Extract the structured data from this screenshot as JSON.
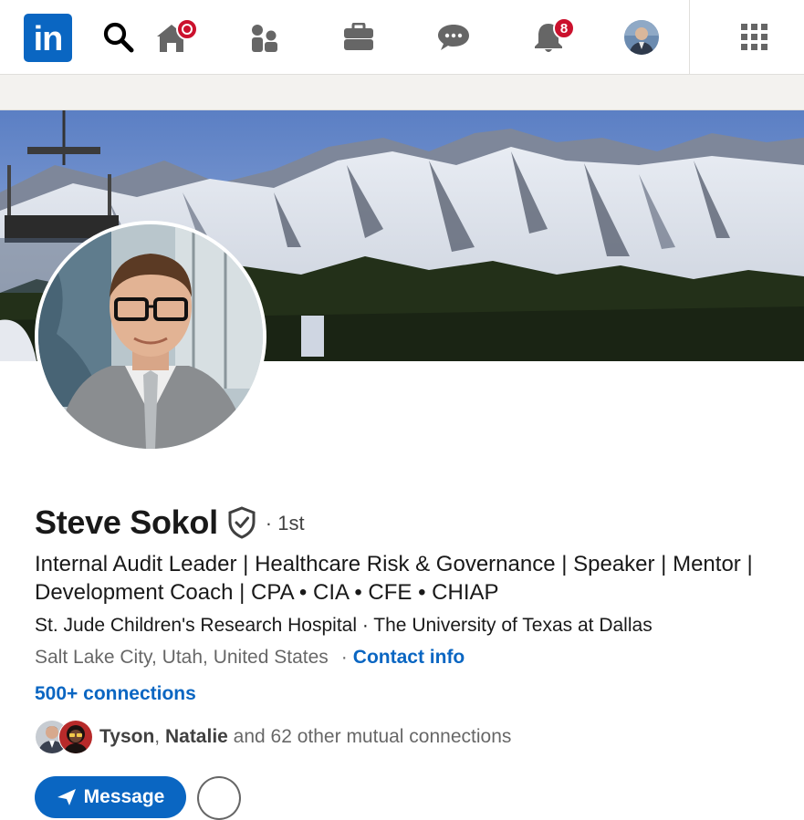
{
  "nav": {
    "logo_text": "in",
    "items": [
      {
        "name": "search",
        "icon": "search-icon"
      },
      {
        "name": "home",
        "icon": "home-icon",
        "badge": "dot"
      },
      {
        "name": "network",
        "icon": "people-icon"
      },
      {
        "name": "jobs",
        "icon": "briefcase-icon"
      },
      {
        "name": "messaging",
        "icon": "chat-icon"
      },
      {
        "name": "notifications",
        "icon": "bell-icon",
        "badge": "8"
      },
      {
        "name": "me",
        "icon": "avatar"
      },
      {
        "name": "apps",
        "icon": "grid-icon"
      }
    ],
    "notifications_badge": "8"
  },
  "profile": {
    "name": "Steve Sokol",
    "degree": "· 1st",
    "headline": "Internal Audit Leader | Healthcare Risk & Governance | Speaker | Mentor | Development Coach | CPA • CIA • CFE • CHIAP",
    "organizations": "St. Jude Children's Research Hospital · The University of Texas at Dallas",
    "location": "Salt Lake City, Utah, United States",
    "separator": "·",
    "contact_info": "Contact info",
    "connections": "500+ connections",
    "mutual": {
      "name1": "Tyson",
      "comma": ", ",
      "name2": "Natalie",
      "rest": " and 62 other mutual connections"
    },
    "message_button": "Message"
  },
  "colors": {
    "brand": "#0a66c2",
    "badge": "#cb112d",
    "nav_icon": "#666666"
  }
}
